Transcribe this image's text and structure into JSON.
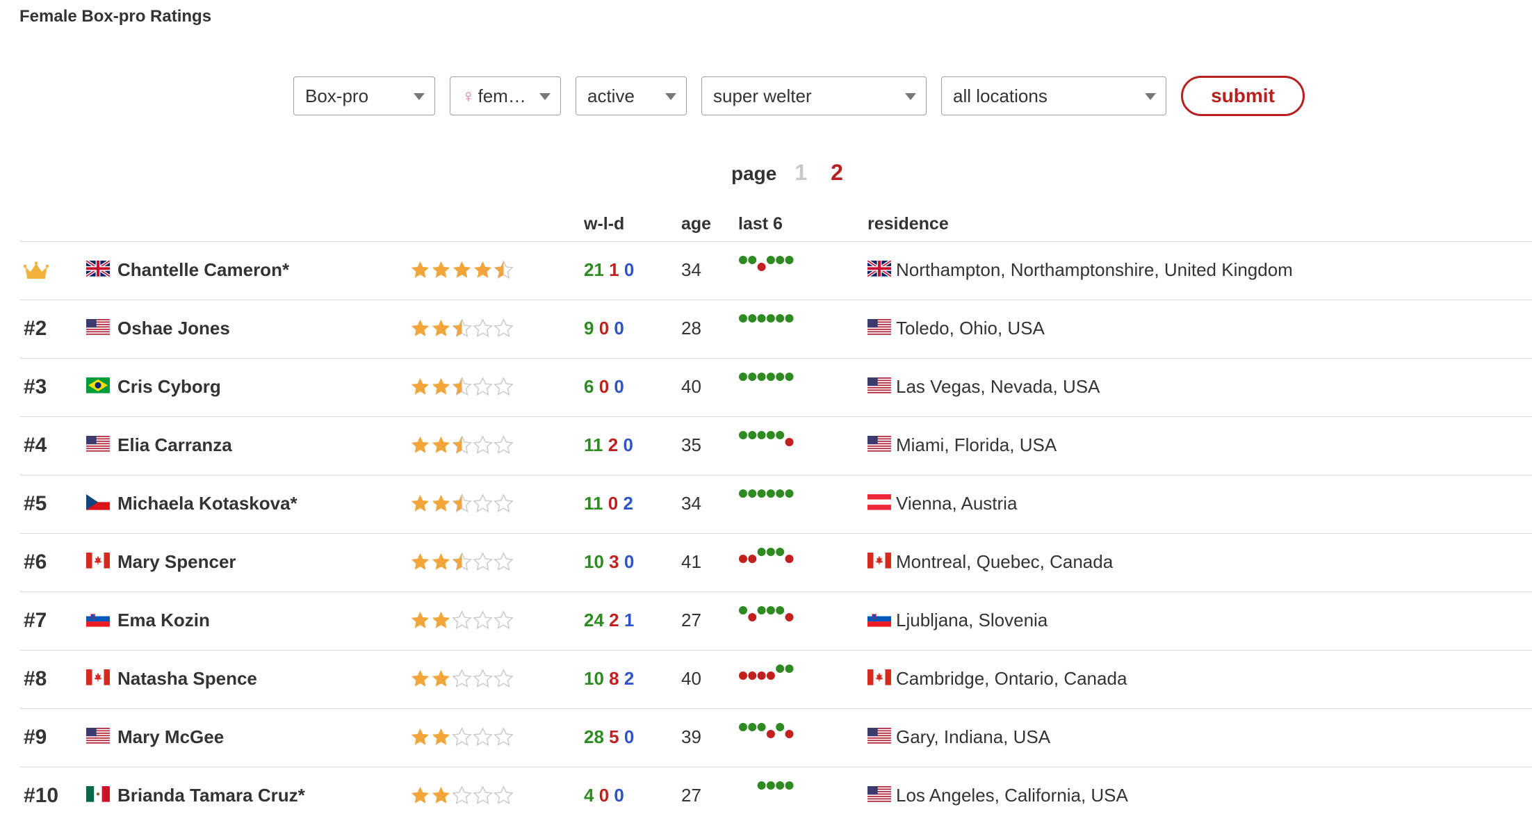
{
  "page_title": "Female Box-pro Ratings",
  "filters": {
    "sport": "Box-pro",
    "gender_icon": "venus-icon",
    "gender": "fem…",
    "status": "active",
    "weight": "super welter",
    "location": "all locations",
    "submit_label": "submit"
  },
  "pagination": {
    "label": "page",
    "pages": [
      "1",
      "2"
    ],
    "current": "2"
  },
  "columns": {
    "wld": "w-l-d",
    "age": "age",
    "last6": "last 6",
    "residence": "residence"
  },
  "colors": {
    "win": "#2e8b22",
    "loss": "#c0201f",
    "draw": "#2d55c9",
    "star": "#f2a53a",
    "accent": "#b8201f"
  },
  "fighters": [
    {
      "rank": "",
      "crown": true,
      "flag": "uk",
      "name": "Chantelle Cameron*",
      "stars": 4.5,
      "w": "21",
      "l": "1",
      "d": "0",
      "age": "34",
      "last6": [
        "W",
        "W",
        "L",
        "W",
        "W",
        "W"
      ],
      "res_flag": "uk",
      "residence": "Northampton, Northamptonshire, United Kingdom"
    },
    {
      "rank": "#2",
      "flag": "us",
      "name": "Oshae Jones",
      "stars": 2.5,
      "w": "9",
      "l": "0",
      "d": "0",
      "age": "28",
      "last6": [
        "W",
        "W",
        "W",
        "W",
        "W",
        "W"
      ],
      "res_flag": "us",
      "residence": "Toledo, Ohio, USA"
    },
    {
      "rank": "#3",
      "flag": "br",
      "name": "Cris Cyborg",
      "stars": 2.5,
      "w": "6",
      "l": "0",
      "d": "0",
      "age": "40",
      "last6": [
        "W",
        "W",
        "W",
        "W",
        "W",
        "W"
      ],
      "res_flag": "us",
      "residence": "Las Vegas, Nevada, USA"
    },
    {
      "rank": "#4",
      "flag": "us",
      "name": "Elia Carranza",
      "stars": 2.5,
      "w": "11",
      "l": "2",
      "d": "0",
      "age": "35",
      "last6": [
        "W",
        "W",
        "W",
        "W",
        "W",
        "L"
      ],
      "res_flag": "us",
      "residence": "Miami, Florida, USA"
    },
    {
      "rank": "#5",
      "flag": "cz",
      "name": "Michaela Kotaskova*",
      "stars": 2.5,
      "w": "11",
      "l": "0",
      "d": "2",
      "age": "34",
      "last6": [
        "W",
        "W",
        "W",
        "W",
        "W",
        "W"
      ],
      "res_flag": "at",
      "residence": "Vienna, Austria"
    },
    {
      "rank": "#6",
      "flag": "ca",
      "name": "Mary Spencer",
      "stars": 2.5,
      "w": "10",
      "l": "3",
      "d": "0",
      "age": "41",
      "last6": [
        "L",
        "L",
        "W",
        "W",
        "W",
        "L"
      ],
      "res_flag": "ca",
      "residence": "Montreal, Quebec, Canada"
    },
    {
      "rank": "#7",
      "flag": "si",
      "name": "Ema Kozin",
      "stars": 2,
      "w": "24",
      "l": "2",
      "d": "1",
      "age": "27",
      "last6": [
        "W",
        "L",
        "W",
        "W",
        "W",
        "L"
      ],
      "res_flag": "si",
      "residence": "Ljubljana, Slovenia"
    },
    {
      "rank": "#8",
      "flag": "ca",
      "name": "Natasha Spence",
      "stars": 2,
      "w": "10",
      "l": "8",
      "d": "2",
      "age": "40",
      "last6": [
        "L",
        "L",
        "L",
        "L",
        "W",
        "W"
      ],
      "res_flag": "ca",
      "residence": "Cambridge, Ontario, Canada"
    },
    {
      "rank": "#9",
      "flag": "us",
      "name": "Mary McGee",
      "stars": 2,
      "w": "28",
      "l": "5",
      "d": "0",
      "age": "39",
      "last6": [
        "W",
        "W",
        "W",
        "L",
        "W",
        "L"
      ],
      "res_flag": "us",
      "residence": "Gary, Indiana, USA"
    },
    {
      "rank": "#10",
      "flag": "mx",
      "name": "Brianda Tamara Cruz*",
      "stars": 2,
      "w": "4",
      "l": "0",
      "d": "0",
      "age": "27",
      "last6": [
        "W",
        "W",
        "W",
        "W"
      ],
      "res_flag": "us",
      "residence": "Los Angeles, California, USA"
    }
  ]
}
